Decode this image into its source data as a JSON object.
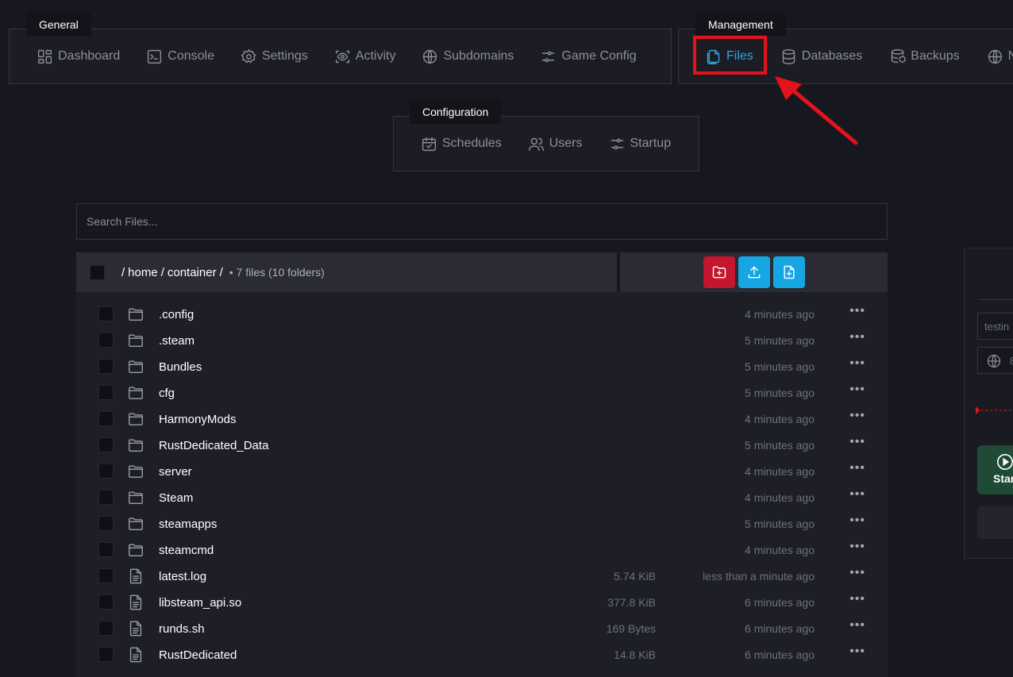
{
  "nav": {
    "general": {
      "title": "General",
      "items": [
        {
          "label": "Dashboard",
          "icon": "dashboard-icon"
        },
        {
          "label": "Console",
          "icon": "terminal-icon"
        },
        {
          "label": "Settings",
          "icon": "gear-icon"
        },
        {
          "label": "Activity",
          "icon": "eye-icon"
        },
        {
          "label": "Subdomains",
          "icon": "globe-icon"
        },
        {
          "label": "Game Config",
          "icon": "sliders-icon"
        }
      ]
    },
    "management": {
      "title": "Management",
      "items": [
        {
          "label": "Files",
          "icon": "files-icon",
          "active": true
        },
        {
          "label": "Databases",
          "icon": "database-icon"
        },
        {
          "label": "Backups",
          "icon": "backup-icon"
        },
        {
          "label": "N",
          "icon": "globe-icon"
        }
      ]
    },
    "configuration": {
      "title": "Configuration",
      "items": [
        {
          "label": "Schedules",
          "icon": "calendar-icon"
        },
        {
          "label": "Users",
          "icon": "users-icon"
        },
        {
          "label": "Startup",
          "icon": "sliders-icon"
        }
      ]
    }
  },
  "search": {
    "placeholder": "Search Files..."
  },
  "file_manager": {
    "breadcrumb": {
      "parts": [
        "home",
        "container"
      ],
      "sep": "/",
      "count_text": "• 7 files (10 folders)"
    },
    "actions": [
      {
        "name": "new-folder-button",
        "color": "#c5162d"
      },
      {
        "name": "upload-button",
        "color": "#16a6e4"
      },
      {
        "name": "new-file-button",
        "color": "#16a6e4"
      }
    ],
    "rows": [
      {
        "type": "folder",
        "name": ".config",
        "size": "",
        "modified": "4 minutes ago"
      },
      {
        "type": "folder",
        "name": ".steam",
        "size": "",
        "modified": "5 minutes ago"
      },
      {
        "type": "folder",
        "name": "Bundles",
        "size": "",
        "modified": "5 minutes ago"
      },
      {
        "type": "folder",
        "name": "cfg",
        "size": "",
        "modified": "5 minutes ago"
      },
      {
        "type": "folder",
        "name": "HarmonyMods",
        "size": "",
        "modified": "4 minutes ago"
      },
      {
        "type": "folder",
        "name": "RustDedicated_Data",
        "size": "",
        "modified": "5 minutes ago"
      },
      {
        "type": "folder",
        "name": "server",
        "size": "",
        "modified": "4 minutes ago"
      },
      {
        "type": "folder",
        "name": "Steam",
        "size": "",
        "modified": "4 minutes ago"
      },
      {
        "type": "folder",
        "name": "steamapps",
        "size": "",
        "modified": "5 minutes ago"
      },
      {
        "type": "folder",
        "name": "steamcmd",
        "size": "",
        "modified": "4 minutes ago"
      },
      {
        "type": "file",
        "name": "latest.log",
        "size": "5.74 KiB",
        "modified": "less than a minute ago"
      },
      {
        "type": "file",
        "name": "libsteam_api.so",
        "size": "377.8 KiB",
        "modified": "6 minutes ago"
      },
      {
        "type": "file",
        "name": "runds.sh",
        "size": "169 Bytes",
        "modified": "6 minutes ago"
      },
      {
        "type": "file",
        "name": "RustDedicated",
        "size": "14.8 KiB",
        "modified": "6 minutes ago"
      }
    ],
    "more_glyph": "•••"
  },
  "side_panel": {
    "server_name": "testin",
    "address": "8",
    "start_label": "Star"
  },
  "colors": {
    "accent": "#2ea7e0",
    "highlight": "#e4131b",
    "background": "#17171f"
  }
}
